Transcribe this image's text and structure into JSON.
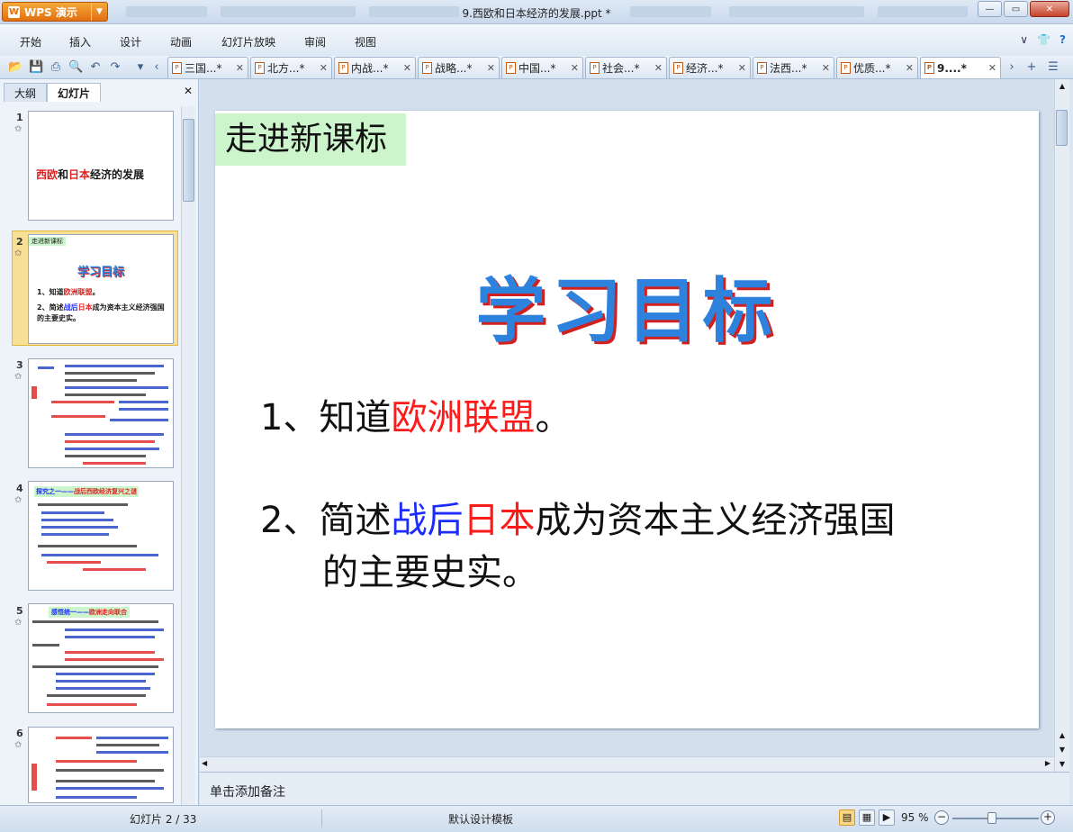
{
  "app": {
    "name": "WPS 演示",
    "window_title": "9.西欧和日本经济的发展.ppt *"
  },
  "menu": [
    "开始",
    "插入",
    "设计",
    "动画",
    "幻灯片放映",
    "审阅",
    "视图"
  ],
  "tabs": [
    {
      "label": "三国...*"
    },
    {
      "label": "北方...*"
    },
    {
      "label": "内战...*"
    },
    {
      "label": "战略...*"
    },
    {
      "label": "中国...*"
    },
    {
      "label": "社会...*"
    },
    {
      "label": "经济...*"
    },
    {
      "label": "法西...*"
    },
    {
      "label": "优质...*"
    },
    {
      "label": "9....*",
      "active": true
    }
  ],
  "panel": {
    "tabs": [
      "大纲",
      "幻灯片"
    ],
    "active_tab": "幻灯片"
  },
  "thumbnails": [
    {
      "num": "1",
      "title_a": "西欧",
      "title_b": "和",
      "title_c": "日本",
      "title_d": "经济的发展"
    },
    {
      "num": "2",
      "kicker": "走进新课标",
      "heading": "学习目标",
      "item1a": "1、知道",
      "item1b": "欧洲联盟",
      "item1c": "。",
      "item2a": "2、简述",
      "item2b": "战后",
      "item2c": "日本",
      "item2d": "成为资本主义经济强国的主要史实。"
    },
    {
      "num": "3"
    },
    {
      "num": "4",
      "heading_a": "探究之一——",
      "heading_b": "战后西欧经济复兴之谜"
    },
    {
      "num": "5",
      "heading_a": "感悟统一——",
      "heading_b": "欧洲走向联合"
    },
    {
      "num": "6"
    }
  ],
  "slide": {
    "kicker": "走进新课标",
    "title": "学习目标",
    "item1": {
      "prefix": "1、知道",
      "red": "欧洲联盟",
      "suffix": "。"
    },
    "item2": {
      "prefix": "2、简述",
      "blue": "战后",
      "red": "日本",
      "suffix_line1": "成为资本主义经济强国",
      "line2": "的主要史实。"
    }
  },
  "notes_placeholder": "单击添加备注",
  "status": {
    "slide_pos": "幻灯片 2 / 33",
    "template": "默认设计模板",
    "zoom": "95 %"
  },
  "colors": {
    "accent": "#f39a2a",
    "title_blue": "#2d82dd",
    "red": "#ff1a1a",
    "blue": "#1c2cff",
    "kicker_bg": "#ccf5cc"
  }
}
